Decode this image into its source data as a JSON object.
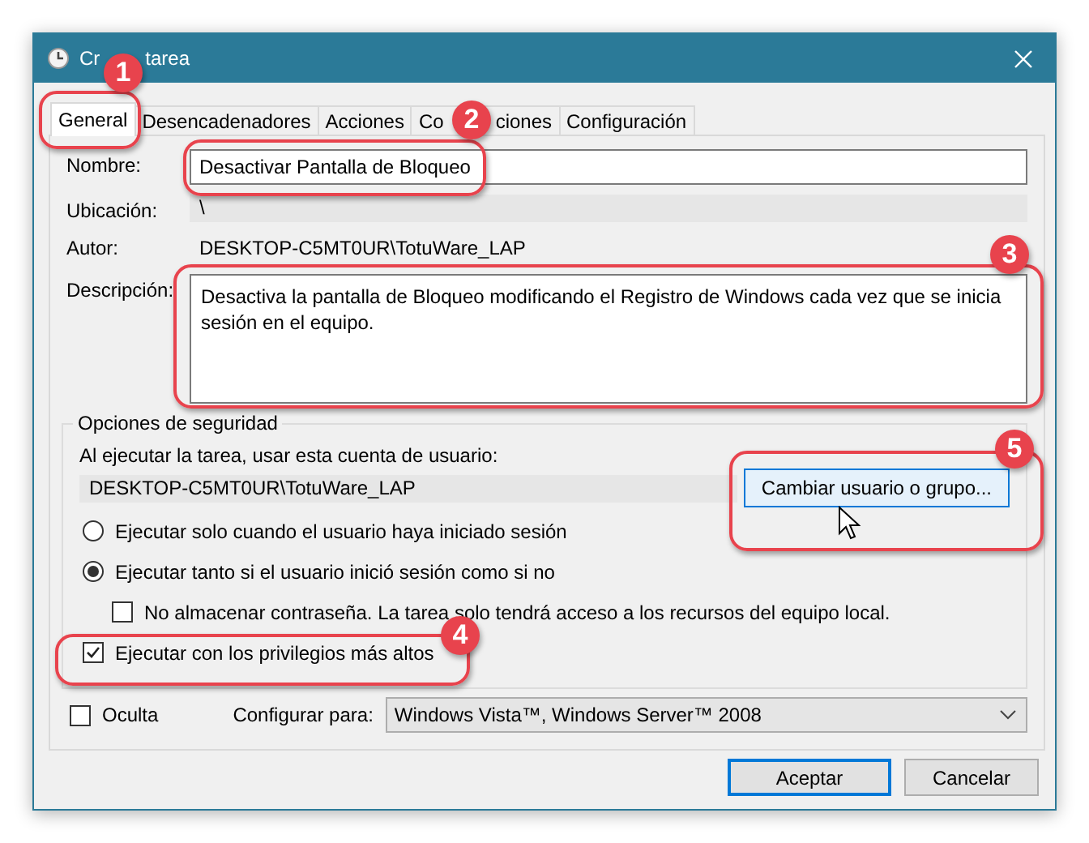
{
  "window": {
    "title_parts": [
      "Cr",
      "tarea"
    ]
  },
  "tabs": [
    {
      "label_parts": [
        "General"
      ],
      "selected": true
    },
    {
      "label_parts": [
        "Desencadenadores"
      ],
      "selected": false
    },
    {
      "label_parts": [
        "Acciones"
      ],
      "selected": false
    },
    {
      "label_parts": [
        "Co",
        "ciones"
      ],
      "selected": false
    },
    {
      "label_parts": [
        "Configuración"
      ],
      "selected": false
    }
  ],
  "general": {
    "name_label": "Nombre:",
    "name": "Desactivar Pantalla de Bloqueo",
    "location_label": "Ubicación:",
    "location": "\\",
    "author_label": "Autor:",
    "author": "DESKTOP-C5MT0UR\\TotuWare_LAP",
    "description_label": "Descripción:",
    "description": "Desactiva la pantalla de Bloqueo modificando el Registro de Windows cada vez que se inicia sesión en el equipo."
  },
  "security": {
    "title": "Opciones de seguridad",
    "account_label": "Al ejecutar la tarea, usar esta cuenta de usuario:",
    "account": "DESKTOP-C5MT0UR\\TotuWare_LAP",
    "change_button": "Cambiar usuario o grupo...",
    "options": [
      {
        "kind": "radio",
        "label": "Ejecutar solo cuando el usuario haya iniciado sesión",
        "selected": false
      },
      {
        "kind": "radio",
        "label": "Ejecutar tanto si el usuario inició sesión como si no",
        "selected": true,
        "children": [
          {
            "kind": "checkbox",
            "label": "No almacenar contraseña. La tarea solo tendrá acceso a los recursos del equipo local.",
            "checked": false
          }
        ]
      },
      {
        "kind": "checkbox",
        "label": "Ejecutar con los privilegios más altos",
        "checked": true
      }
    ]
  },
  "hidden": {
    "label": "Oculta",
    "checked": false
  },
  "configure": {
    "label": "Configurar para:",
    "value": "Windows Vista™, Windows Server™ 2008"
  },
  "buttons": [
    {
      "label": "Aceptar",
      "default": true
    },
    {
      "label": "Cancelar",
      "default": false
    }
  ],
  "annotations": [
    "1",
    "2",
    "3",
    "4",
    "5"
  ]
}
